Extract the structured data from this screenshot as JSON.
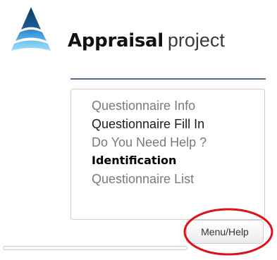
{
  "brand": {
    "name_bold": "Appraisal",
    "name_light": "project",
    "logo_icon": "blue-sail-logo-icon",
    "accent_color": "#1f6fb5"
  },
  "menu": {
    "items": [
      {
        "label": "Questionnaire Info"
      },
      {
        "label": "Questionnaire Fill In"
      },
      {
        "label": "Do You Need Help ?"
      },
      {
        "label": "Identification"
      },
      {
        "label": "Questionnaire List"
      }
    ]
  },
  "menu_button": {
    "label": "Menu/Help"
  },
  "highlight": {
    "color": "#e0101a"
  }
}
